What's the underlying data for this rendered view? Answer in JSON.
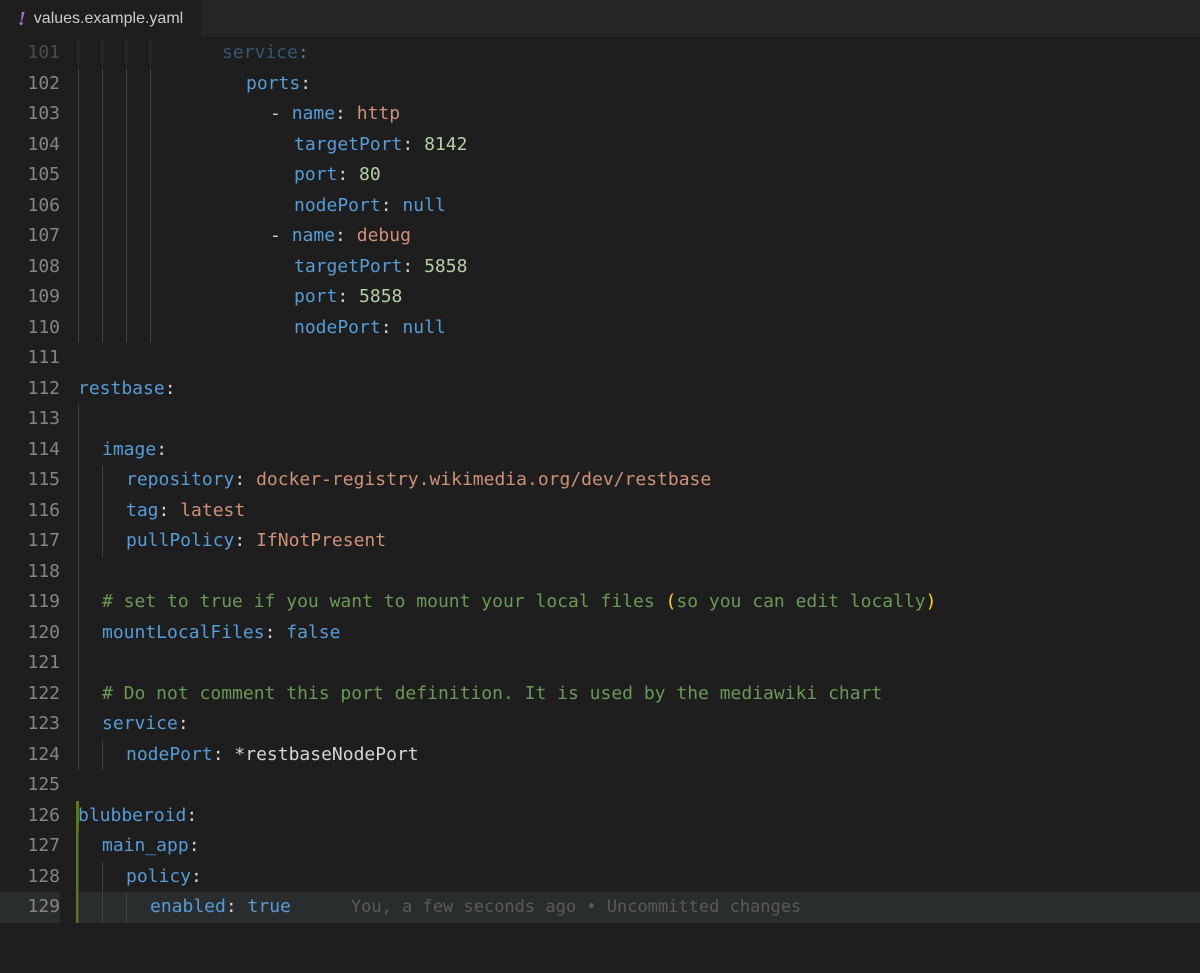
{
  "tab": {
    "filename": "values.example.yaml"
  },
  "gutter": {
    "start": 101,
    "end": 129,
    "changed_start": 126,
    "changed_end": 129
  },
  "blame": {
    "text": "You, a few seconds ago • Uncommitted changes"
  },
  "code": {
    "l101": {
      "indent": 6,
      "guides": 4,
      "tokens": [
        [
          "key",
          "service"
        ],
        [
          "punc",
          ":"
        ]
      ]
    },
    "l102": {
      "indent": 7,
      "guides": 4,
      "tokens": [
        [
          "key",
          "ports"
        ],
        [
          "punc",
          ":"
        ]
      ]
    },
    "l103": {
      "indent": 8,
      "guides": 4,
      "tokens": [
        [
          "punc",
          "- "
        ],
        [
          "key",
          "name"
        ],
        [
          "punc",
          ": "
        ],
        [
          "str",
          "http"
        ]
      ]
    },
    "l104": {
      "indent": 9,
      "guides": 4,
      "tokens": [
        [
          "key",
          "targetPort"
        ],
        [
          "punc",
          ": "
        ],
        [
          "num",
          "8142"
        ]
      ]
    },
    "l105": {
      "indent": 9,
      "guides": 4,
      "tokens": [
        [
          "key",
          "port"
        ],
        [
          "punc",
          ": "
        ],
        [
          "num",
          "80"
        ]
      ]
    },
    "l106": {
      "indent": 9,
      "guides": 4,
      "tokens": [
        [
          "key",
          "nodePort"
        ],
        [
          "punc",
          ": "
        ],
        [
          "null",
          "null"
        ]
      ]
    },
    "l107": {
      "indent": 8,
      "guides": 4,
      "tokens": [
        [
          "punc",
          "- "
        ],
        [
          "key",
          "name"
        ],
        [
          "punc",
          ": "
        ],
        [
          "str",
          "debug"
        ]
      ]
    },
    "l108": {
      "indent": 9,
      "guides": 4,
      "tokens": [
        [
          "key",
          "targetPort"
        ],
        [
          "punc",
          ": "
        ],
        [
          "num",
          "5858"
        ]
      ]
    },
    "l109": {
      "indent": 9,
      "guides": 4,
      "tokens": [
        [
          "key",
          "port"
        ],
        [
          "punc",
          ": "
        ],
        [
          "num",
          "5858"
        ]
      ]
    },
    "l110": {
      "indent": 9,
      "guides": 4,
      "tokens": [
        [
          "key",
          "nodePort"
        ],
        [
          "punc",
          ": "
        ],
        [
          "null",
          "null"
        ]
      ]
    },
    "l111": {
      "indent": 0,
      "guides": 0,
      "tokens": []
    },
    "l112": {
      "indent": 0,
      "guides": 0,
      "tokens": [
        [
          "key",
          "restbase"
        ],
        [
          "punc",
          ":"
        ]
      ]
    },
    "l113": {
      "indent": 0,
      "guides": 1,
      "tokens": []
    },
    "l114": {
      "indent": 1,
      "guides": 1,
      "tokens": [
        [
          "key",
          "image"
        ],
        [
          "punc",
          ":"
        ]
      ]
    },
    "l115": {
      "indent": 2,
      "guides": 2,
      "tokens": [
        [
          "key",
          "repository"
        ],
        [
          "punc",
          ": "
        ],
        [
          "str",
          "docker-registry.wikimedia.org/dev/restbase"
        ]
      ]
    },
    "l116": {
      "indent": 2,
      "guides": 2,
      "tokens": [
        [
          "key",
          "tag"
        ],
        [
          "punc",
          ": "
        ],
        [
          "str",
          "latest"
        ]
      ]
    },
    "l117": {
      "indent": 2,
      "guides": 2,
      "tokens": [
        [
          "key",
          "pullPolicy"
        ],
        [
          "punc",
          ": "
        ],
        [
          "str",
          "IfNotPresent"
        ]
      ]
    },
    "l118": {
      "indent": 0,
      "guides": 1,
      "tokens": []
    },
    "l119": {
      "indent": 1,
      "guides": 1,
      "tokens": [
        [
          "comment",
          "# set to true if you want to mount your local files "
        ],
        [
          "paren",
          "("
        ],
        [
          "comment",
          "so you can edit locally"
        ],
        [
          "paren",
          ")"
        ]
      ]
    },
    "l120": {
      "indent": 1,
      "guides": 1,
      "tokens": [
        [
          "key",
          "mountLocalFiles"
        ],
        [
          "punc",
          ": "
        ],
        [
          "null",
          "false"
        ]
      ]
    },
    "l121": {
      "indent": 0,
      "guides": 1,
      "tokens": []
    },
    "l122": {
      "indent": 1,
      "guides": 1,
      "tokens": [
        [
          "comment",
          "# Do not comment this port definition. It is used by the mediawiki chart"
        ]
      ]
    },
    "l123": {
      "indent": 1,
      "guides": 1,
      "tokens": [
        [
          "key",
          "service"
        ],
        [
          "punc",
          ":"
        ]
      ]
    },
    "l124": {
      "indent": 2,
      "guides": 2,
      "tokens": [
        [
          "key",
          "nodePort"
        ],
        [
          "punc",
          ": "
        ],
        [
          "alias",
          "*restbaseNodePort"
        ]
      ]
    },
    "l125": {
      "indent": 0,
      "guides": 0,
      "tokens": []
    },
    "l126": {
      "indent": 0,
      "guides": 0,
      "tokens": [
        [
          "key",
          "blubberoid"
        ],
        [
          "punc",
          ":"
        ]
      ]
    },
    "l127": {
      "indent": 1,
      "guides": 1,
      "tokens": [
        [
          "key",
          "main_app"
        ],
        [
          "punc",
          ":"
        ]
      ]
    },
    "l128": {
      "indent": 2,
      "guides": 2,
      "tokens": [
        [
          "key",
          "policy"
        ],
        [
          "punc",
          ":"
        ]
      ]
    },
    "l129": {
      "indent": 3,
      "guides": 3,
      "tokens": [
        [
          "key",
          "enabled"
        ],
        [
          "punc",
          ": "
        ],
        [
          "null",
          "true"
        ]
      ],
      "blame": true
    }
  }
}
